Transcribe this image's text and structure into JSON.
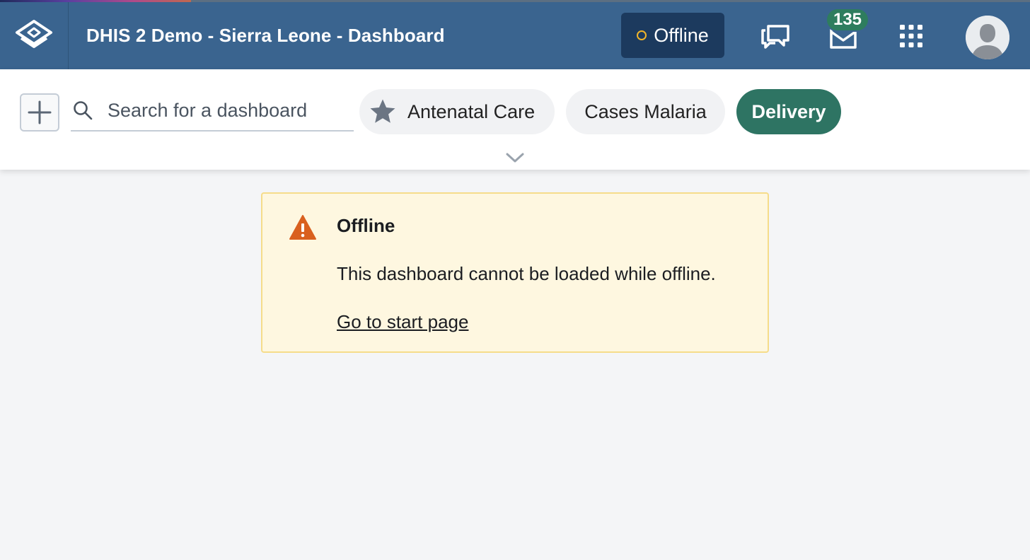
{
  "header": {
    "title": "DHIS 2 Demo - Sierra Leone - Dashboard",
    "offline_label": "Offline",
    "message_count": "135",
    "icons": [
      "dhis2-logo-icon",
      "interpretations-icon",
      "messages-icon",
      "apps-grid-icon",
      "user-avatar-icon"
    ],
    "colors": {
      "bar": "#3a648f",
      "offline_badge": "#1c3a5e",
      "status_dot": "#f0b429",
      "count_badge": "#2e7d5e"
    }
  },
  "controls": {
    "search_placeholder": "Search for a dashboard",
    "chips": [
      {
        "label": "Antenatal Care",
        "starred": true,
        "selected": false
      },
      {
        "label": "Cases Malaria",
        "starred": false,
        "selected": false
      },
      {
        "label": "Delivery",
        "starred": false,
        "selected": true
      }
    ],
    "selected_color": "#2e7463"
  },
  "notice": {
    "title": "Offline",
    "message": "This dashboard cannot be loaded while offline.",
    "link": "Go to start page",
    "colors": {
      "background": "#fef7e0",
      "border": "#f6dc8a",
      "icon": "#d9601f"
    }
  }
}
